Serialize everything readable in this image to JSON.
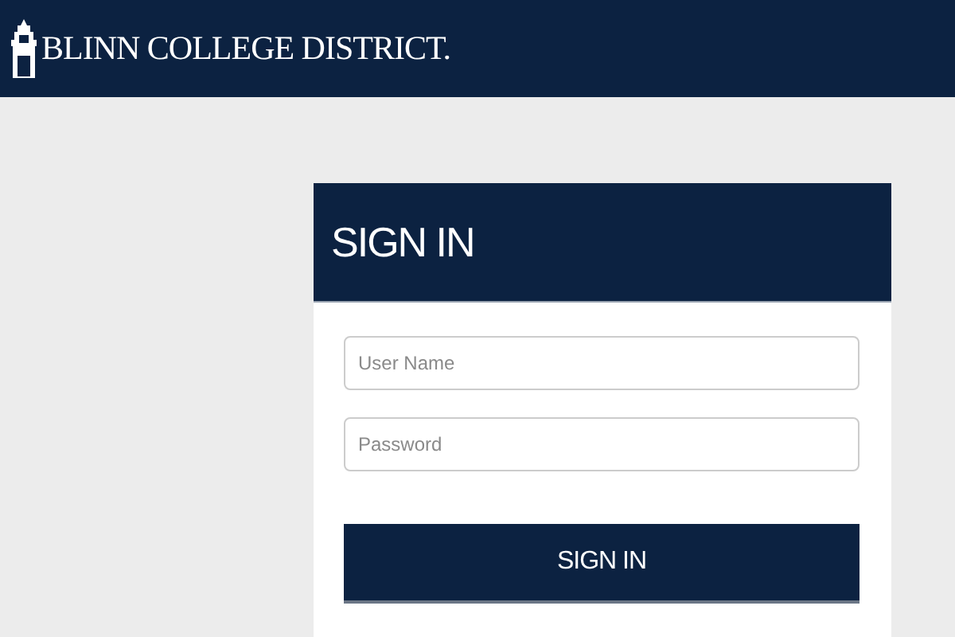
{
  "header": {
    "logo_text": "BLINN COLLEGE DISTRICT."
  },
  "login": {
    "title": "SIGN IN",
    "fields": [
      {
        "placeholder": "User Name"
      },
      {
        "placeholder": "Password"
      }
    ],
    "button": "SIGN IN"
  }
}
